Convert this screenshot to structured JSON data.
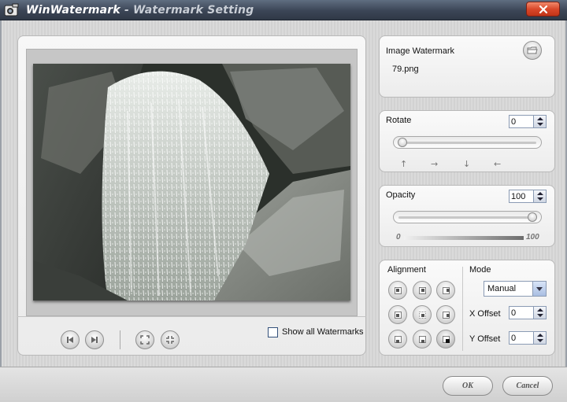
{
  "window": {
    "app_name": "WinWatermark",
    "title_suffix": " - Watermark Setting"
  },
  "preview": {
    "show_all_label": "Show all Watermarks",
    "show_all_checked": false,
    "toolbar_icons": [
      "first-icon",
      "last-icon",
      "fit-view-icon",
      "actual-size-icon"
    ]
  },
  "image_watermark": {
    "label": "Image Watermark",
    "filename": "79.png"
  },
  "rotate": {
    "label": "Rotate",
    "value": "0",
    "slider_fraction": 0.0,
    "directions": [
      "↑",
      "→",
      "↓",
      "←"
    ]
  },
  "opacity": {
    "label": "Opacity",
    "value": "100",
    "slider_fraction": 1.0,
    "scale_min": "0",
    "scale_max": "100"
  },
  "alignment": {
    "label": "Alignment",
    "selected": "bottom-right"
  },
  "mode": {
    "label": "Mode",
    "selected": "Manual",
    "x_offset_label": "X Offset",
    "x_offset_value": "0",
    "y_offset_label": "Y Offset",
    "y_offset_value": "0"
  },
  "buttons": {
    "ok": "OK",
    "cancel": "Cancel"
  },
  "colors": {
    "titlebar": "#3b4556",
    "close_button": "#d9482a",
    "panel_background": "#f3f3f3"
  }
}
